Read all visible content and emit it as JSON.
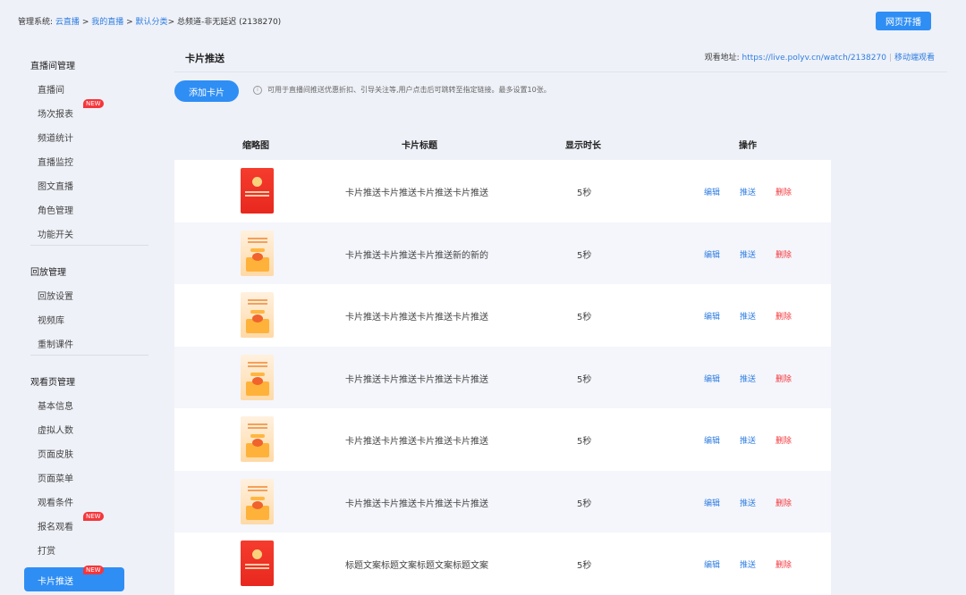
{
  "breadcrumb": {
    "prefix": "管理系统:",
    "items": [
      "云直播",
      "我的直播",
      "默认分类"
    ],
    "sep": ">",
    "current": "总频道-非无延迟 (2138270)"
  },
  "header": {
    "live_button": "网页开播"
  },
  "sidebar": {
    "groups": [
      {
        "title": "直播间管理",
        "items": [
          "直播间",
          "场次报表",
          "频道统计",
          "直播监控",
          "图文直播",
          "角色管理",
          "功能开关"
        ]
      },
      {
        "title": "回放管理",
        "items": [
          "回放设置",
          "视频库",
          "重制课件"
        ]
      },
      {
        "title": "观看页管理",
        "items": [
          "基本信息",
          "虚拟人数",
          "页面皮肤",
          "页面菜单",
          "观看条件",
          "报名观看",
          "打赏"
        ]
      }
    ],
    "active_item": "卡片推送",
    "badge": "NEW"
  },
  "main": {
    "title": "卡片推送",
    "watch_label": "观看地址:",
    "watch_url": "https://live.polyv.cn/watch/2138270",
    "watch_sep": "|",
    "mobile_link": "移动端观看",
    "add_button": "添加卡片",
    "tip_icon": "i",
    "tip": "可用于直播间推送优惠折扣、引导关注等,用户点击后可跳转至指定链接。最多设置10张。"
  },
  "table": {
    "columns": [
      "缩略图",
      "卡片标题",
      "显示时长",
      "操作"
    ],
    "actions": {
      "edit": "编辑",
      "push": "推送",
      "delete": "删除"
    },
    "rows": [
      {
        "thumb": "red-envelope",
        "title": "卡片推送卡片推送卡片推送卡片推送",
        "duration": "5秒"
      },
      {
        "thumb": "gift-card",
        "title": "卡片推送卡片推送卡片推送新的新的",
        "duration": "5秒"
      },
      {
        "thumb": "gift-card",
        "title": "卡片推送卡片推送卡片推送卡片推送",
        "duration": "5秒"
      },
      {
        "thumb": "gift-card",
        "title": "卡片推送卡片推送卡片推送卡片推送",
        "duration": "5秒"
      },
      {
        "thumb": "gift-card",
        "title": "卡片推送卡片推送卡片推送卡片推送",
        "duration": "5秒"
      },
      {
        "thumb": "gift-card",
        "title": "卡片推送卡片推送卡片推送卡片推送",
        "duration": "5秒"
      },
      {
        "thumb": "red-envelope",
        "title": "标题文案标题文案标题文案标题文案",
        "duration": "5秒"
      }
    ]
  },
  "colors": {
    "accent": "#2f8ef4",
    "link": "#2f7de1",
    "danger": "#f5363b",
    "background": "#eef1f8"
  }
}
